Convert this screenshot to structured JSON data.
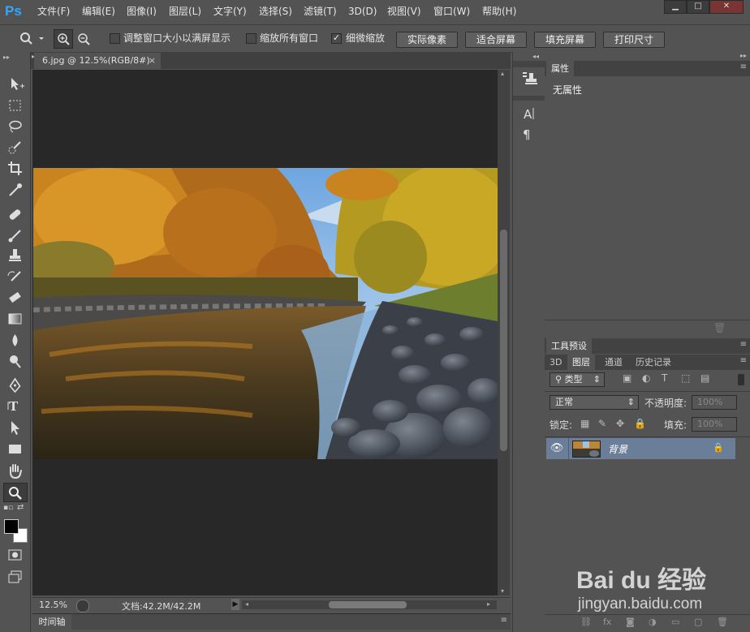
{
  "app": {
    "logo": "Ps"
  },
  "menu": [
    {
      "label": "文件(F)"
    },
    {
      "label": "编辑(E)"
    },
    {
      "label": "图像(I)"
    },
    {
      "label": "图层(L)"
    },
    {
      "label": "文字(Y)"
    },
    {
      "label": "选择(S)"
    },
    {
      "label": "滤镜(T)"
    },
    {
      "label": "3D(D)"
    },
    {
      "label": "视图(V)"
    },
    {
      "label": "窗口(W)"
    },
    {
      "label": "帮助(H)"
    }
  ],
  "window_controls": {
    "minimize": "▁",
    "maximize": "□",
    "close": "✕"
  },
  "options_bar": {
    "resize_windows_label": "调整窗口大小以满屏显示",
    "resize_windows_checked": false,
    "zoom_all_label": "缩放所有窗口",
    "zoom_all_checked": false,
    "scrubby_zoom_label": "细微缩放",
    "scrubby_zoom_checked": true,
    "actual_pixels": "实际像素",
    "fit_screen": "适合屏幕",
    "fill_screen": "填充屏幕",
    "print_size": "打印尺寸"
  },
  "document": {
    "tab_title": "6.jpg @ 12.5%(RGB/8#)",
    "close": "×",
    "zoom": "12.5%",
    "doc_info": "文档:42.2M/42.2M"
  },
  "timeline": {
    "label": "时间轴"
  },
  "properties_panel": {
    "tab": "属性",
    "content": "无属性"
  },
  "tool_presets": {
    "tab": "工具预设"
  },
  "layers_panel": {
    "tabs": [
      {
        "label": "3D"
      },
      {
        "label": "图层"
      },
      {
        "label": "通道"
      },
      {
        "label": "历史记录"
      }
    ],
    "active_tab": "图层",
    "filter_kind": "类型",
    "blend_mode": "正常",
    "opacity_label": "不透明度:",
    "opacity_value": "100%",
    "lock_label": "锁定:",
    "fill_label": "填充:",
    "fill_value": "100%",
    "layers": [
      {
        "name": "背景",
        "visible": true,
        "locked": true
      }
    ]
  },
  "watermark": {
    "brand": "Bai du 经验",
    "url": "jingyan.baidu.com"
  },
  "colors": {
    "accent": "#31a8ff",
    "selected_layer": "#6a7d99",
    "canvas_bg": "#282828",
    "panel_bg": "#535353"
  }
}
